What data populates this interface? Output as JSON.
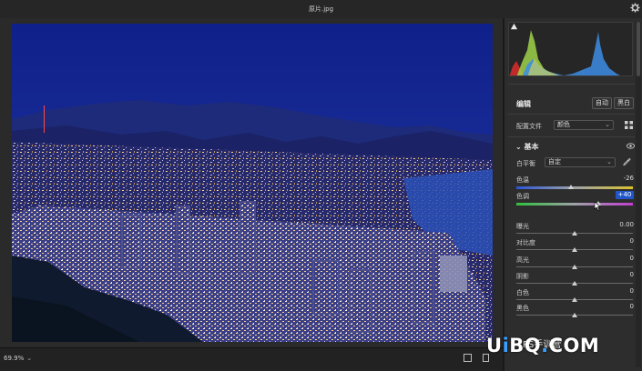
{
  "window": {
    "title": "原片.jpg"
  },
  "bottom": {
    "zoom": "69.9%",
    "zoom_caret": "⌄"
  },
  "panel": {
    "edit_label": "编辑",
    "auto_button": "自动",
    "bw_button": "黑白",
    "profile_label": "配置文件",
    "profile_value": "颜色",
    "section_basic": "基本",
    "wb_label": "白平衡",
    "wb_value": "自定",
    "sliders": [
      {
        "label": "色温",
        "value": "-26",
        "level": 0.47
      },
      {
        "label": "色调",
        "value": "+40",
        "level": 0.7,
        "active": true
      },
      {
        "label": "曝光",
        "value": "0.00",
        "level": 0.5
      },
      {
        "label": "对比度",
        "value": "0",
        "level": 0.5
      },
      {
        "label": "高光",
        "value": "0",
        "level": 0.5
      },
      {
        "label": "阴影",
        "value": "0",
        "level": 0.5
      },
      {
        "label": "白色",
        "value": "0",
        "level": 0.5
      },
      {
        "label": "黑色",
        "value": "0",
        "level": 0.5
      }
    ]
  },
  "watermark": {
    "text_u": "U",
    "text_i": "i",
    "text_bq": "BQ",
    "text_dot": ".",
    "text_com": "COM",
    "wechat": "PS手训营"
  },
  "colors": {
    "accent": "#1f56c9",
    "panel_bg": "#2d2d2d",
    "sky": "#1a2c8f"
  },
  "icons": [
    "gear-icon",
    "histogram-clip-icon",
    "profile-grid-icon",
    "eye-icon",
    "eyedropper-icon",
    "chevron-down-icon",
    "view-toggle-icon"
  ]
}
